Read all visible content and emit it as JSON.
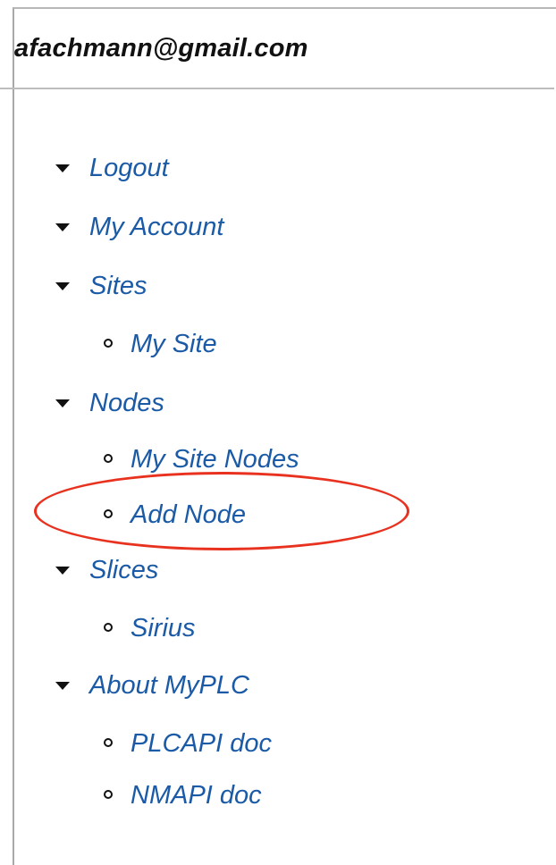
{
  "user": {
    "email": "afachmann@gmail.com"
  },
  "menu": {
    "logout": "Logout",
    "my_account": "My Account",
    "sites": {
      "label": "Sites",
      "children": [
        "My Site"
      ]
    },
    "nodes": {
      "label": "Nodes",
      "children": [
        "My Site Nodes",
        "Add Node"
      ]
    },
    "slices": {
      "label": "Slices",
      "children": [
        "Sirius"
      ]
    },
    "about": {
      "label": "About MyPLC",
      "children": [
        "PLCAPI doc",
        "NMAPI doc"
      ]
    }
  },
  "annotation": {
    "highlighted_item": "Add Node",
    "color": "#e8321f"
  },
  "colors": {
    "link": "#1a5aa6",
    "text": "#111111",
    "border": "#a9a9a9"
  }
}
